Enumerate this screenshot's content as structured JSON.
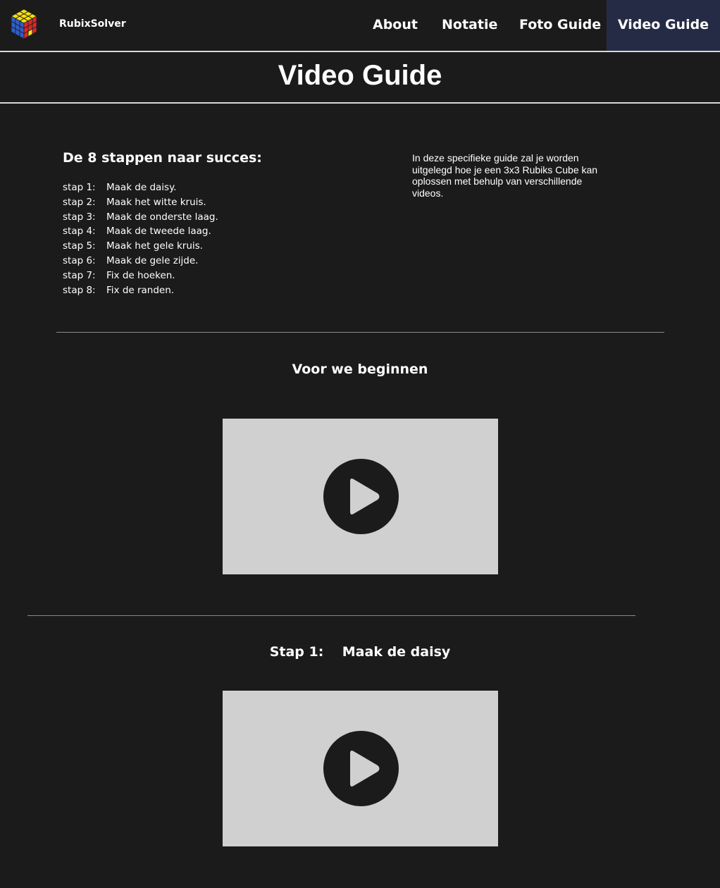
{
  "brand": {
    "name": "RubixSolver"
  },
  "nav": [
    {
      "label": "About"
    },
    {
      "label": "Notatie"
    },
    {
      "label": "Foto Guide"
    },
    {
      "label": "Video Guide",
      "active": true
    }
  ],
  "page_title": "Video Guide",
  "steps_section": {
    "heading": "De 8 stappen naar succes:",
    "steps": [
      {
        "num": "stap 1:",
        "text": "Maak de daisy."
      },
      {
        "num": "stap 2:",
        "text": "Maak het witte kruis."
      },
      {
        "num": "stap 3:",
        "text": "Maak de onderste laag."
      },
      {
        "num": "stap 4:",
        "text": "Maak de tweede laag."
      },
      {
        "num": "stap 5:",
        "text": "Maak het gele kruis."
      },
      {
        "num": "stap 6:",
        "text": "Maak de gele zijde."
      },
      {
        "num": "stap 7:",
        "text": "Fix de hoeken."
      },
      {
        "num": "stap 8:",
        "text": "Fix de randen."
      }
    ]
  },
  "intro_text": "In deze specifieke guide zal je worden uitgelegd hoe je een 3x3 Rubiks Cube kan oplossen met behulp van verschillende videos.",
  "sections": [
    {
      "heading": "Voor we beginnen"
    },
    {
      "heading": "Stap 1:    Maak de daisy"
    }
  ],
  "colors": {
    "background": "#1b1b1b",
    "active_nav": "#262b45",
    "video_placeholder": "#d0d0d0",
    "play_button": "#1b1b1b"
  },
  "icons": {
    "logo": "rubiks-cube-icon",
    "play": "play-icon"
  }
}
